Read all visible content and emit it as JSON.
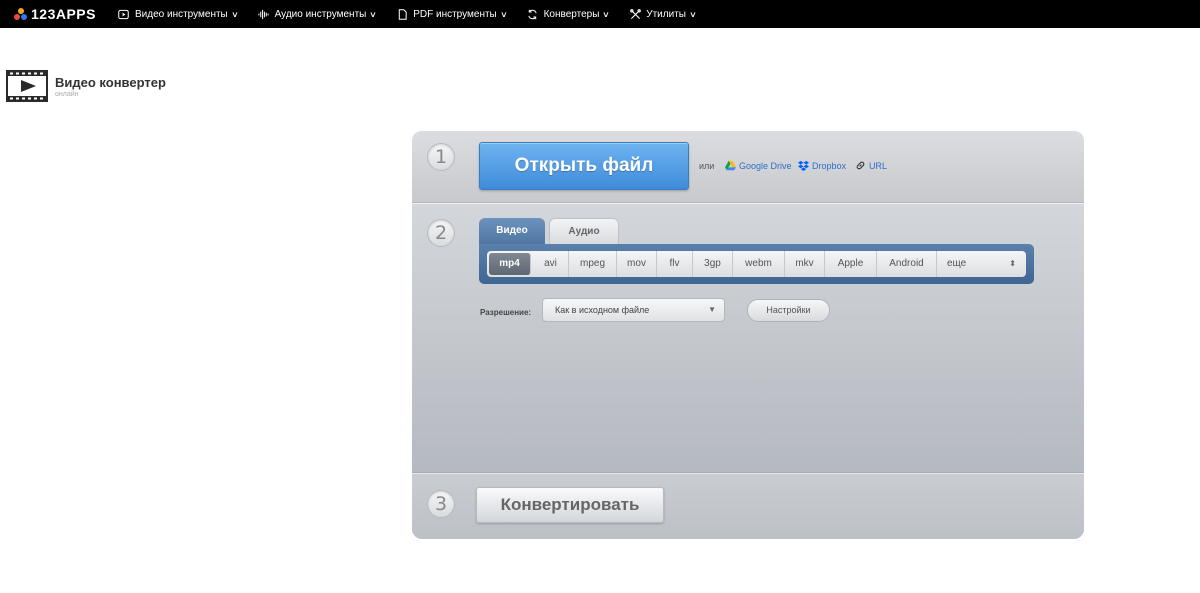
{
  "nav": {
    "logo": "123APPS",
    "items": [
      {
        "label": "Видео инструменты",
        "icon": "play-icon"
      },
      {
        "label": "Аудио инструменты",
        "icon": "audio-wave-icon"
      },
      {
        "label": "PDF инструменты",
        "icon": "document-icon"
      },
      {
        "label": "Конвертеры",
        "icon": "convert-icon"
      },
      {
        "label": "Утилиты",
        "icon": "tools-icon"
      }
    ]
  },
  "app": {
    "title": "Видео конвертер",
    "subtitle": "онлайн"
  },
  "step1": {
    "number": "1",
    "open_label": "Открыть файл",
    "or": "или",
    "sources": {
      "google_drive": "Google Drive",
      "dropbox": "Dropbox",
      "url": "URL"
    }
  },
  "step2": {
    "number": "2",
    "tabs": {
      "video": "Видео",
      "audio": "Аудио"
    },
    "formats": [
      "mp4",
      "avi",
      "mpeg",
      "mov",
      "flv",
      "3gp",
      "webm",
      "mkv",
      "Apple",
      "Android"
    ],
    "more": "еще",
    "resolution_label": "Разрешение:",
    "resolution_value": "Как в исходном файле",
    "settings_label": "Настройки"
  },
  "step3": {
    "number": "3",
    "convert_label": "Конвертировать"
  },
  "colors": {
    "accent_blue": "#3e8bd9",
    "tab_blue": "#4e75a0",
    "link_blue": "#2c6fc7"
  }
}
